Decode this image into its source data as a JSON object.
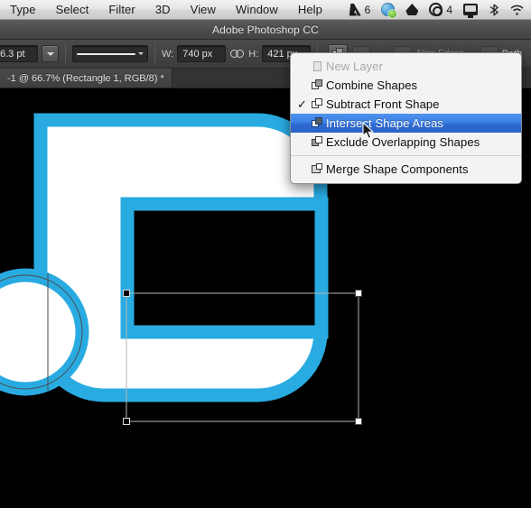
{
  "menubar": {
    "items": [
      {
        "label": "Type"
      },
      {
        "label": "Select"
      },
      {
        "label": "Filter"
      },
      {
        "label": "3D"
      },
      {
        "label": "View"
      },
      {
        "label": "Window"
      },
      {
        "label": "Help"
      }
    ],
    "tray": {
      "adobe_icon": "adobe-a-icon",
      "adobe_count": "6",
      "globe_icon": "globe-sync-icon",
      "drive_icon": "google-drive-icon",
      "cc_icon": "creative-cloud-icon",
      "cc_count": "4",
      "display_icon": "display-icon",
      "bluetooth_icon": "bluetooth-icon",
      "wifi_icon": "wifi-icon"
    }
  },
  "titlebar": {
    "title": "Adobe Photoshop CC"
  },
  "optionsbar": {
    "stroke_width_value": "6.3 pt",
    "stroke_width_caret": "chevron-down-icon",
    "stroke_style_preview": "stroke-style-preview",
    "width_label": "W:",
    "width_value": "740 px",
    "link_icon": "link-chain-icon",
    "height_label": "H:",
    "height_value": "421 px",
    "path_ops_button": "path-operations-icon",
    "align_label": "Align Edges",
    "path_label": "Path"
  },
  "document_tab": {
    "label": "-1 @ 66.7% (Rectangle 1, RGB/8) *"
  },
  "dropdown": {
    "items": [
      {
        "label": "New Layer",
        "icon": "new-layer-icon",
        "checked": false,
        "disabled": true,
        "selected": false
      },
      {
        "label": "Combine Shapes",
        "icon": "combine-shapes-icon",
        "checked": false,
        "disabled": false,
        "selected": false
      },
      {
        "label": "Subtract Front Shape",
        "icon": "subtract-front-shape-icon",
        "checked": true,
        "disabled": false,
        "selected": false
      },
      {
        "label": "Intersect Shape Areas",
        "icon": "intersect-shape-areas-icon",
        "checked": false,
        "disabled": false,
        "selected": true
      },
      {
        "label": "Exclude Overlapping Shapes",
        "icon": "exclude-overlapping-shapes-icon",
        "checked": false,
        "disabled": false,
        "selected": false
      }
    ],
    "footer_items": [
      {
        "label": "Merge Shape Components",
        "icon": "merge-shape-components-icon",
        "checked": false,
        "disabled": false,
        "selected": false
      }
    ],
    "check_glyph": "✓",
    "highlight_color": "#3b7fe4"
  },
  "canvas": {
    "background_color": "#000000",
    "shape_stroke_color": "#29abe2",
    "shape_fill_color": "#ffffff",
    "path_outline_color": "#3a3a3a",
    "selection_box_color": "#b4b4b4",
    "anchor_point_color": "#000000",
    "handle_color": "#ffffff"
  }
}
